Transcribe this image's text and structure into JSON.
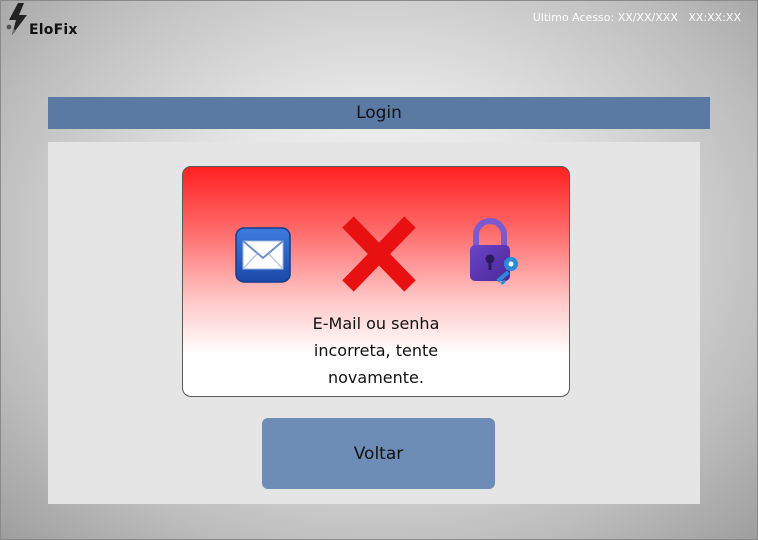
{
  "app": {
    "brand": "EloFix"
  },
  "header": {
    "last_access": "Ultimo Acesso: XX/XX/XXX   XX:XX:XX"
  },
  "login": {
    "title": "Login"
  },
  "error": {
    "message": "E-Mail ou senha incorreta, tente novamente.",
    "icons": [
      "mail-icon",
      "error-x-icon",
      "lock-with-key-icon"
    ]
  },
  "actions": {
    "back_label": "Voltar"
  },
  "colors": {
    "bar": "#5a7aa3",
    "button": "#6d8db7",
    "error_top": "#ff2020",
    "error_x": "#e81010",
    "lock": "#5b35b0",
    "key": "#2b8bd6"
  }
}
